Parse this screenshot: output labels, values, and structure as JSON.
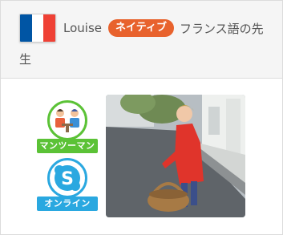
{
  "teacher": {
    "name": "Louise",
    "badge": "ネイティブ",
    "title_suffix": "フランス語の先",
    "title_wrap": "生",
    "flag_colors": [
      "#0055a4",
      "#ffffff",
      "#ef4135"
    ]
  },
  "lesson_types": [
    {
      "label": "マンツーマン",
      "icon": "one-to-one-lesson-icon",
      "color": "#5bc236"
    },
    {
      "label": "オンライン",
      "icon": "skype-icon",
      "color": "#2aa8e0"
    }
  ],
  "photo": {
    "icon": "teacher-photo"
  }
}
